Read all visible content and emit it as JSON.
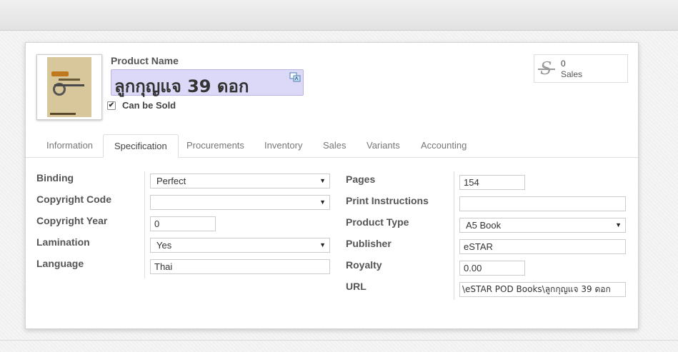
{
  "product": {
    "name_label": "Product Name",
    "name": "ลูกกุญแจ 39 ดอก",
    "can_be_sold_label": "Can be Sold",
    "can_be_sold": true,
    "image_icon": "book-cover-image"
  },
  "stat": {
    "value": "0",
    "label": "Sales",
    "icon": "strikethrough-dollar-icon"
  },
  "tabs": [
    {
      "label": "Information"
    },
    {
      "label": "Specification",
      "active": true
    },
    {
      "label": "Procurements"
    },
    {
      "label": "Inventory"
    },
    {
      "label": "Sales"
    },
    {
      "label": "Variants"
    },
    {
      "label": "Accounting"
    }
  ],
  "left_fields": {
    "binding": {
      "label": "Binding",
      "value": "Perfect"
    },
    "copyright_code": {
      "label": "Copyright Code",
      "value": ""
    },
    "copyright_year": {
      "label": "Copyright Year",
      "value": "0"
    },
    "lamination": {
      "label": "Lamination",
      "value": "Yes"
    },
    "language": {
      "label": "Language",
      "value": "Thai"
    }
  },
  "right_fields": {
    "pages": {
      "label": "Pages",
      "value": "154"
    },
    "print_instructions": {
      "label": "Print Instructions",
      "value": ""
    },
    "product_type": {
      "label": "Product Type",
      "value": "A5 Book"
    },
    "publisher": {
      "label": "Publisher",
      "value": "eSTAR"
    },
    "royalty": {
      "label": "Royalty",
      "value": "0.00"
    },
    "url": {
      "label": "URL",
      "value": "\\eSTAR POD Books\\ลูกกุญแจ 39 ดอก"
    }
  },
  "colors": {
    "name_highlight": "#dcd9f8",
    "accent_text": "#555555"
  }
}
